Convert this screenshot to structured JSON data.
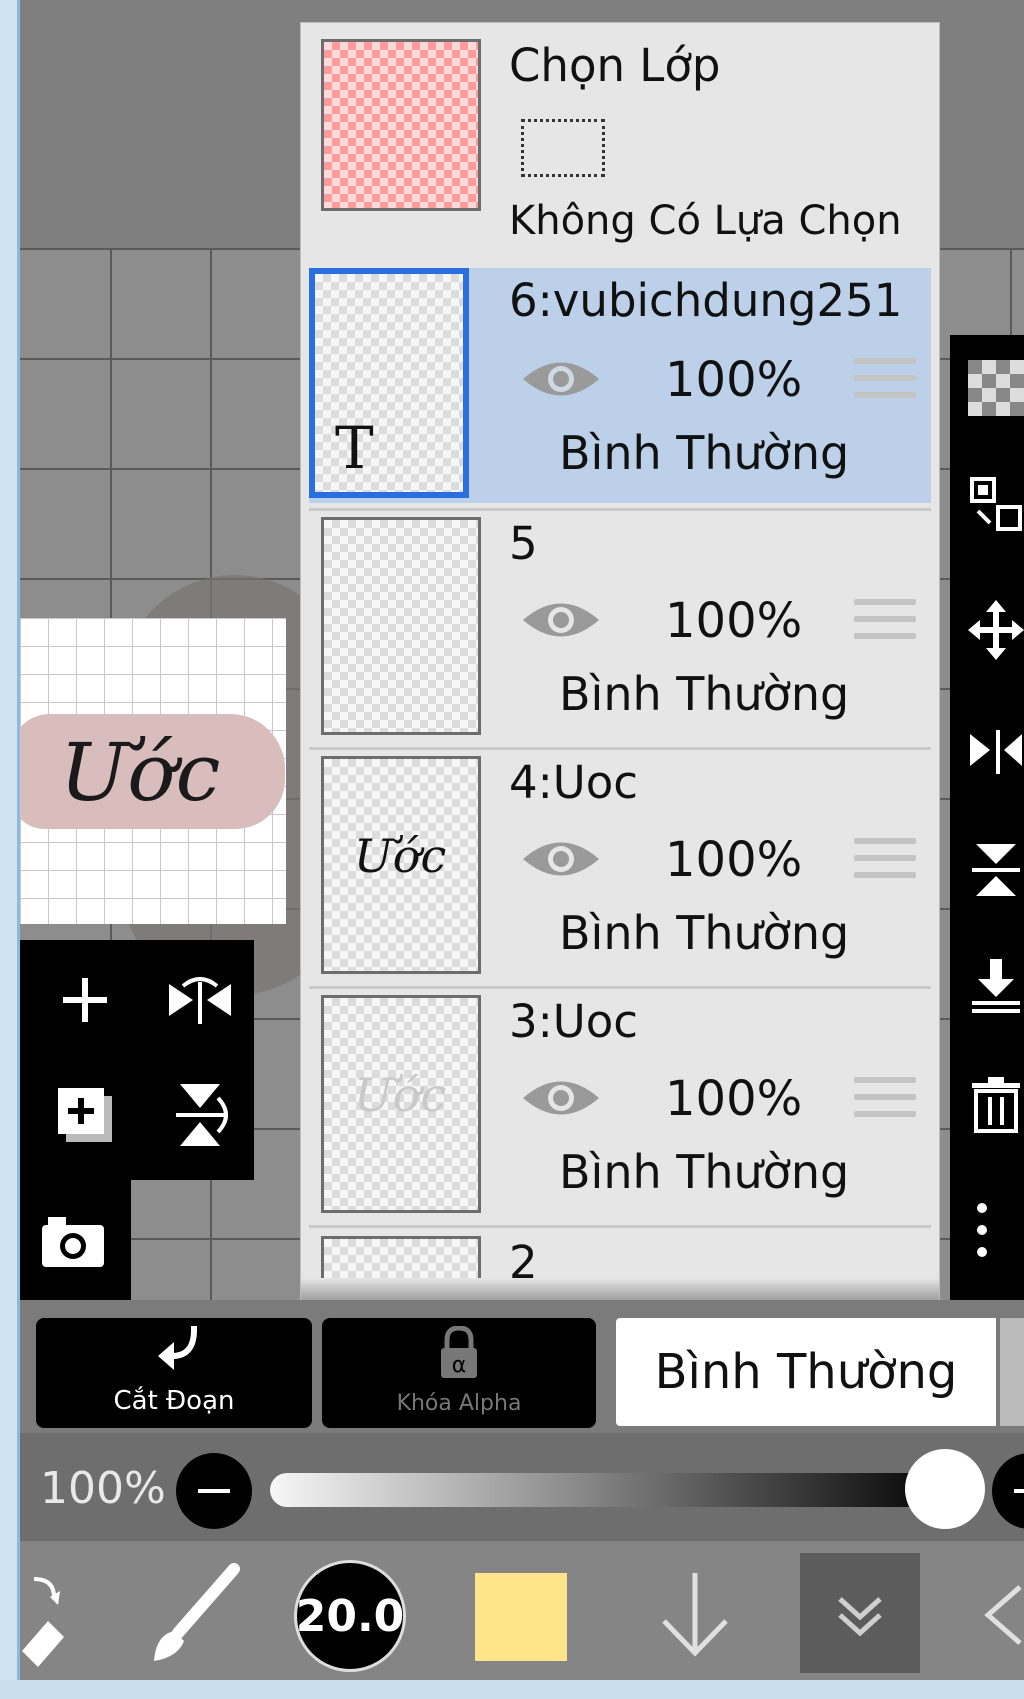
{
  "layer_panel": {
    "selection": {
      "title": "Chọn Lớp",
      "status": "Không Có Lựa Chọn"
    },
    "layers": [
      {
        "name": "6:vubichdung251",
        "opacity": "100%",
        "blend_mode": "Bình Thường",
        "selected": true,
        "thumb_glyph": "T"
      },
      {
        "name": "5",
        "opacity": "100%",
        "blend_mode": "Bình Thường",
        "selected": false
      },
      {
        "name": "4:Uoc",
        "opacity": "100%",
        "blend_mode": "Bình Thường",
        "selected": false,
        "thumb_text": "Ước"
      },
      {
        "name": "3:Uoc",
        "opacity": "100%",
        "blend_mode": "Bình Thường",
        "selected": false,
        "thumb_text": "Ước"
      },
      {
        "name": "2"
      }
    ]
  },
  "artwork": {
    "word": "Ước"
  },
  "bottom_bar": {
    "clipping_label": "Cắt Đoạn",
    "alpha_lock_label": "Khóa Alpha",
    "blend_mode": "Bình Thường"
  },
  "opacity": {
    "label": "100%",
    "level": 1.0
  },
  "toolbar": {
    "brush_size": "20.0",
    "current_color": "#ffe58a"
  },
  "colors": {
    "selection_blue": "#2a6fe0",
    "selected_row": "#bcd0ea",
    "panel_bg": "#e6e6e6"
  }
}
